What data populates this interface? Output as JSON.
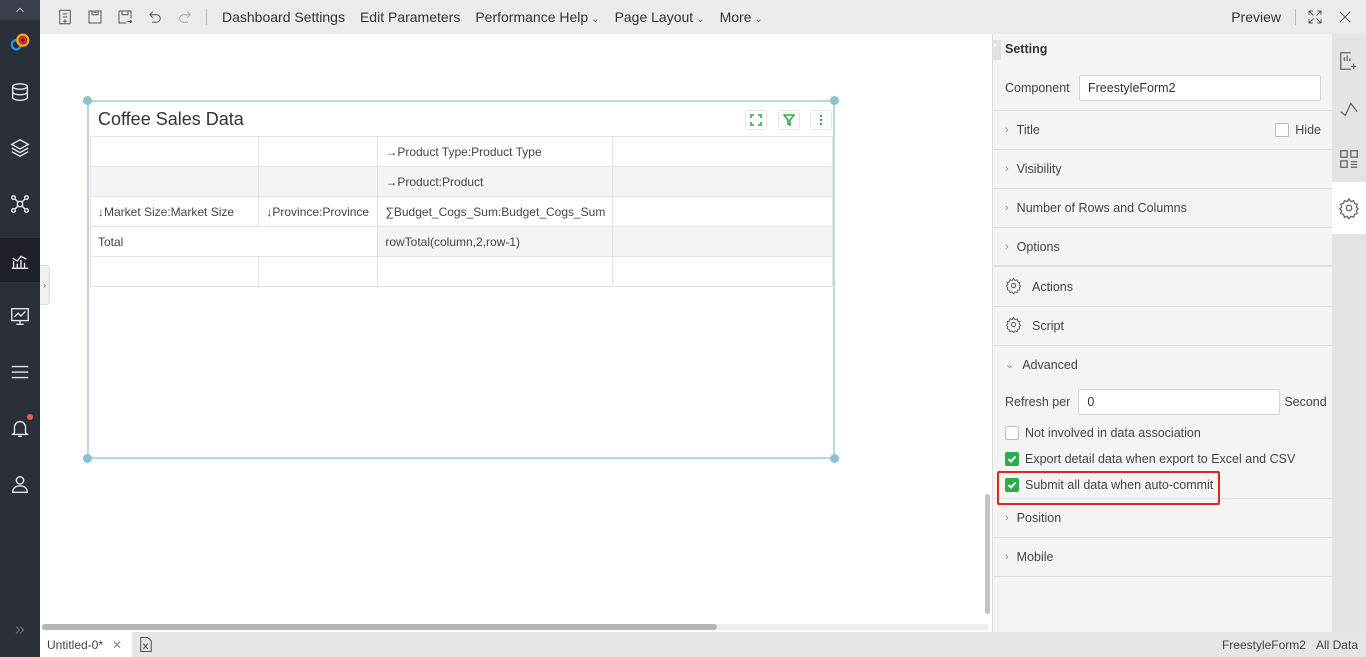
{
  "toolbar": {
    "icons": [
      "new-page-icon",
      "save-icon",
      "save-as-icon",
      "undo-icon",
      "redo-icon"
    ],
    "menu": [
      "Dashboard Settings",
      "Edit Parameters",
      "Performance Help",
      "Page Layout",
      "More"
    ],
    "preview": "Preview"
  },
  "sidebar": {
    "icons": [
      "collapse-up-icon",
      "logo",
      "database-icon",
      "layers-icon",
      "network-icon",
      "analysis-chart-icon",
      "monitor-icon",
      "menu-icon",
      "bell-icon",
      "user-icon",
      "expand-icon"
    ],
    "active": "analysis-chart-icon"
  },
  "component": {
    "title": "Coffee Sales Data",
    "rows": [
      [
        "",
        "",
        "→Product Type:Product Type",
        ""
      ],
      [
        "",
        "",
        "→Product:Product",
        ""
      ],
      [
        "↓Market Size:Market Size",
        "↓Province:Province",
        "∑Budget_Cogs_Sum:Budget_Cogs_Sum",
        ""
      ],
      [
        "Total",
        "rowTotal(column,2,row-1)",
        ""
      ],
      [
        "",
        "",
        "",
        ""
      ]
    ]
  },
  "panel": {
    "header": "Setting",
    "component_label": "Component",
    "component_value": "FreestyleForm2",
    "title": "Title",
    "hide": "Hide",
    "visibility": "Visibility",
    "rows_cols": "Number of Rows and Columns",
    "options": "Options",
    "actions": "Actions",
    "script": "Script",
    "advanced": "Advanced",
    "refresh_label": "Refresh per",
    "refresh_value": "0",
    "refresh_unit": "Second",
    "checks": [
      {
        "label": "Not involved in data association",
        "checked": false
      },
      {
        "label": "Export detail data when export to Excel and CSV",
        "checked": true
      },
      {
        "label": "Submit all data when auto-commit",
        "checked": true
      }
    ],
    "position": "Position",
    "mobile": "Mobile"
  },
  "status": {
    "tab": "Untitled-0*",
    "component": "FreestyleForm2",
    "scope": "All Data"
  },
  "colors": {
    "accent": "#2dab4f",
    "highlight": "#e8231f",
    "sidebar": "#2b2f3a"
  }
}
